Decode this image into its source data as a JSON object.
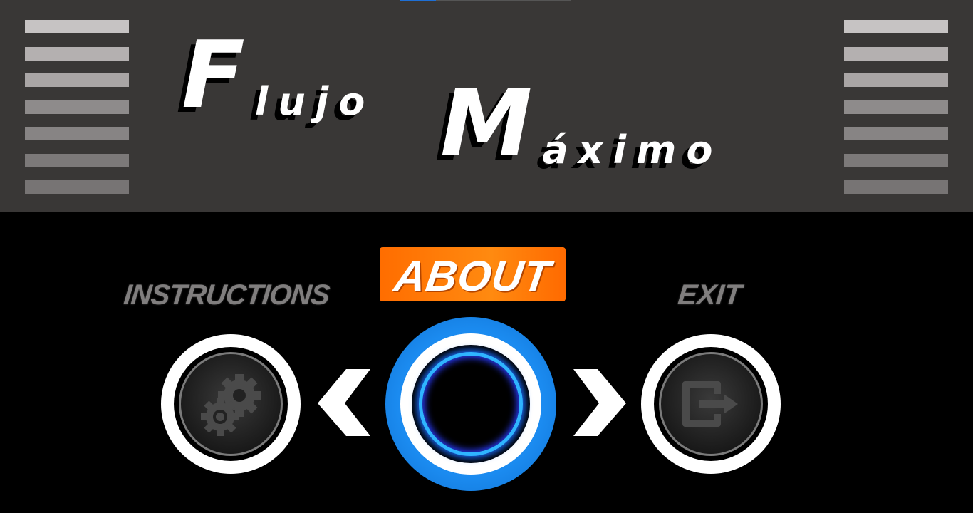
{
  "title": {
    "word1_initial": "F",
    "word1_rest": "lujo",
    "word2_initial": "M",
    "word2_rest": "áximo"
  },
  "menu": {
    "instructions_label": "INSTRUCTIONS",
    "about_label": "ABOUT",
    "exit_label": "EXIT"
  },
  "icons": {
    "instructions": "gears-icon",
    "about": "glowing-ring-icon",
    "exit": "exit-door-icon",
    "prev": "chevron-left-icon",
    "next": "chevron-right-icon"
  },
  "colors": {
    "header_bg": "#393736",
    "about_badge": "#ff7a00",
    "selected_ring": "#1b8bf0",
    "inactive_label": "#807e7e"
  }
}
